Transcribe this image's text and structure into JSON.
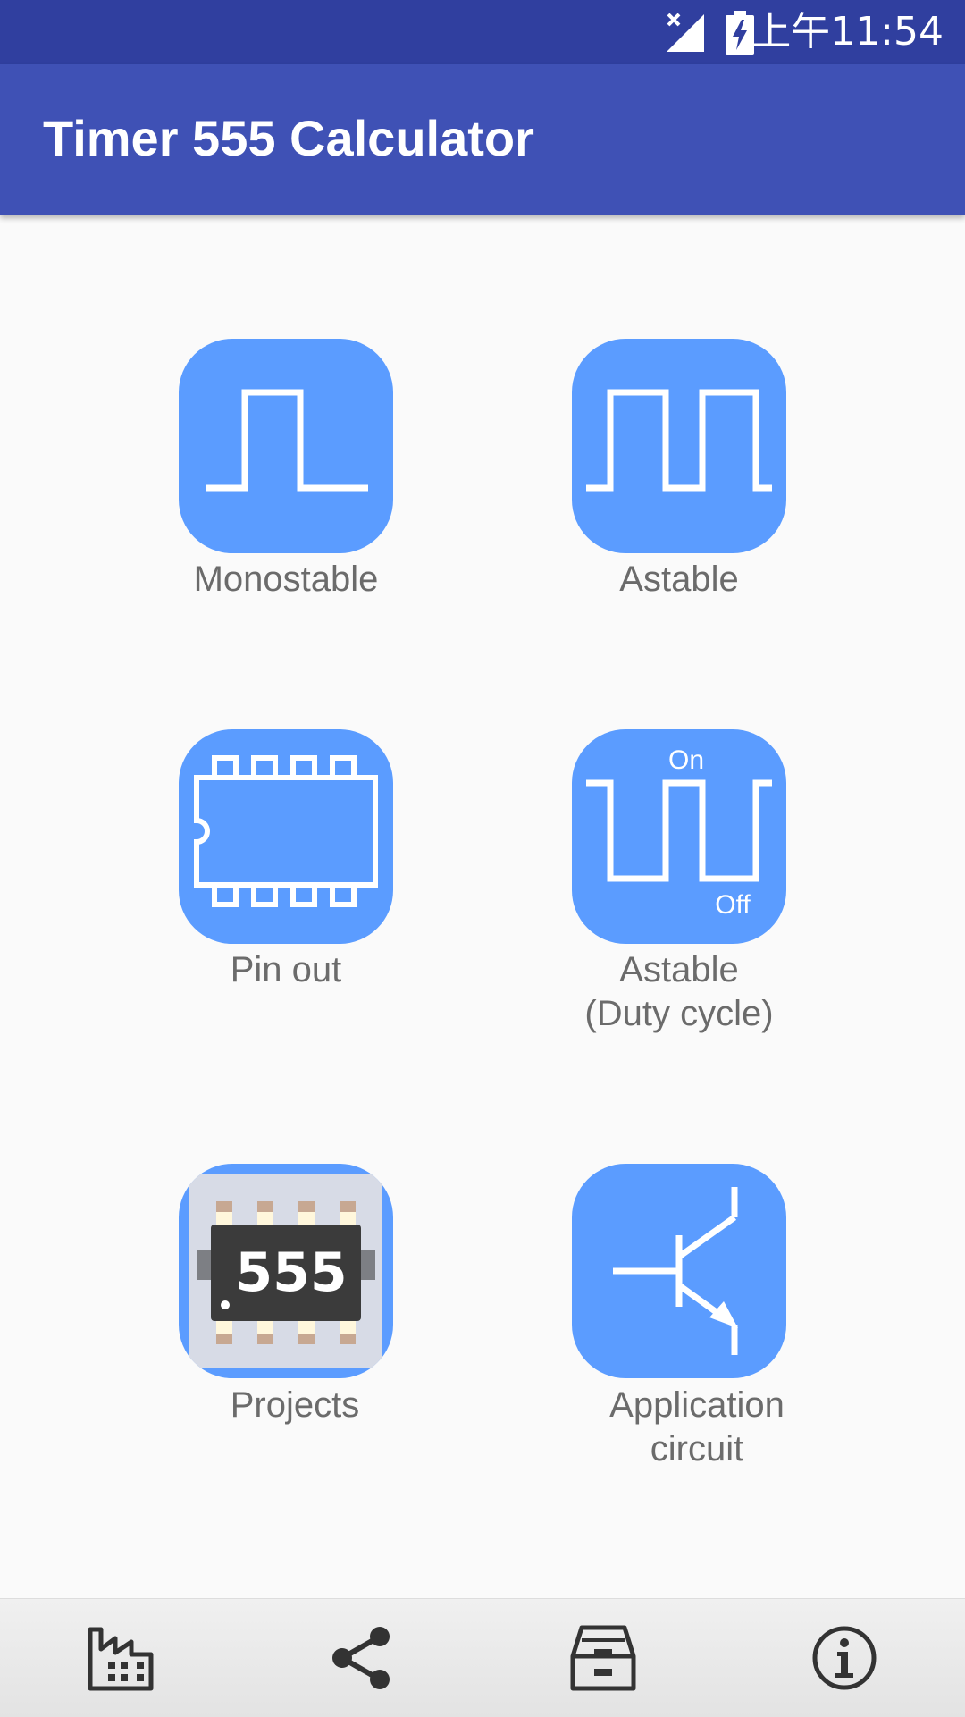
{
  "status_bar": {
    "time": "上午11:54",
    "signal_icon": "signal-no-service-icon",
    "battery_icon": "battery-charging-icon"
  },
  "app_bar": {
    "title": "Timer 555 Calculator",
    "color": "#3f51b5"
  },
  "menu": {
    "tile_color": "#5b9cff",
    "items": [
      {
        "label_lines": [
          "Monostable"
        ],
        "icon": "monostable-pulse-icon"
      },
      {
        "label_lines": [
          "Astable"
        ],
        "icon": "astable-square-wave-icon"
      },
      {
        "label_lines": [
          "Pin out"
        ],
        "icon": "ic-chip-pinout-icon"
      },
      {
        "label_lines": [
          "Astable",
          "(Duty cycle)"
        ],
        "icon": "duty-cycle-wave-icon",
        "icon_text": {
          "on": "On",
          "off": "Off"
        }
      },
      {
        "label_lines": [
          "Projects"
        ],
        "icon": "555-chip-icon",
        "icon_text": "555"
      },
      {
        "label_lines": [
          "Application",
          "circuit"
        ],
        "icon": "transistor-icon"
      }
    ]
  },
  "bottom_bar": {
    "items": [
      {
        "icon": "factory-icon"
      },
      {
        "icon": "share-icon"
      },
      {
        "icon": "archive-icon"
      },
      {
        "icon": "info-icon"
      }
    ]
  }
}
